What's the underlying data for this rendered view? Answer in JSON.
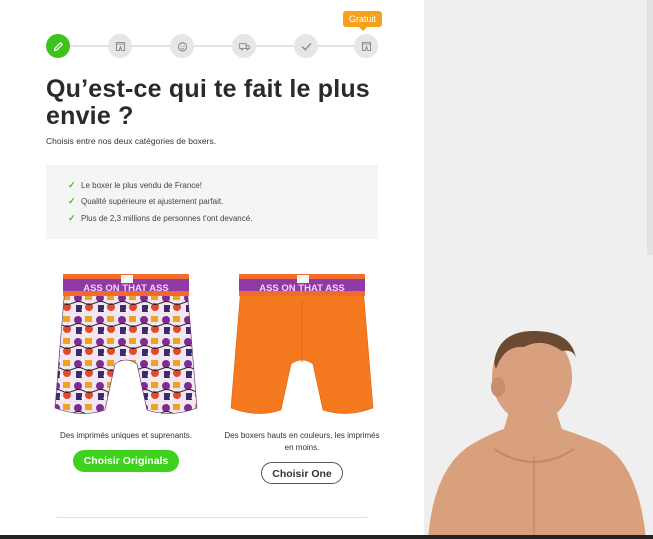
{
  "progress": {
    "badge": "Gratuit",
    "steps": [
      {
        "icon": "pencil-icon",
        "active": true
      },
      {
        "icon": "boxer-icon",
        "active": false
      },
      {
        "icon": "face-icon",
        "active": false
      },
      {
        "icon": "truck-icon",
        "active": false
      },
      {
        "icon": "check-icon",
        "active": false
      },
      {
        "icon": "boxer-icon",
        "active": false
      }
    ]
  },
  "header": {
    "title": "Qu’est-ce qui te fait le plus envie ?",
    "subtitle": "Choisis entre nos deux catégories de boxers."
  },
  "benefits": [
    "Le boxer le plus vendu de France!",
    "Qualité supérieure et ajustement parfait.",
    "Plus de 2,3 millions de personnes t'ont devancé."
  ],
  "products": [
    {
      "waistband_text": "ASS ON THAT ASS",
      "description": "Des imprimés uniques et suprenants.",
      "button": "Choisir Originals"
    },
    {
      "waistband_text": "ASS ON THAT ASS",
      "description": "Des boxers hauts en couleurs, les imprimés en moins.",
      "button": "Choisir One"
    }
  ],
  "colors": {
    "accent_green": "#3cc31e",
    "badge_orange": "#f6a11a",
    "boxer_orange": "#f57a1f",
    "waistband_purple": "#8f3aa6"
  }
}
